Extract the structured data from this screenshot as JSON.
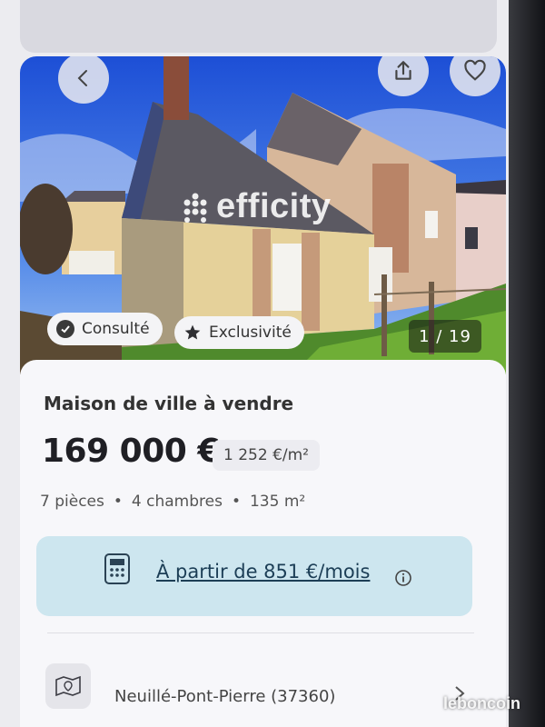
{
  "listing": {
    "agency_watermark": "efficity",
    "badges": {
      "consulted": "Consulté",
      "exclusive": "Exclusivité"
    },
    "photo_counter": "1 / 19",
    "title": "Maison de ville à vendre",
    "price": "169 000 €",
    "price_per_m2": "1 252 €/m²",
    "specs": {
      "rooms": "7 pièces",
      "bedrooms": "4 chambres",
      "area": "135 m²",
      "separator": "•"
    },
    "financing": "À partir de 851 €/mois",
    "location": "Neuillé-Pont-Pierre (37360)"
  },
  "brand": "leboncoin",
  "icons": {
    "back": "chevron-left-icon",
    "share": "share-icon",
    "favorite": "heart-icon",
    "consulted": "check-circle-icon",
    "exclusive": "star-icon",
    "calculator": "calculator-icon",
    "info": "info-icon",
    "map": "map-icon",
    "chevron": "chevron-right-icon"
  },
  "colors": {
    "financing_bg": "#cde6ef",
    "financing_text": "#1c3e56",
    "card_bg": "#f7f7fa"
  }
}
